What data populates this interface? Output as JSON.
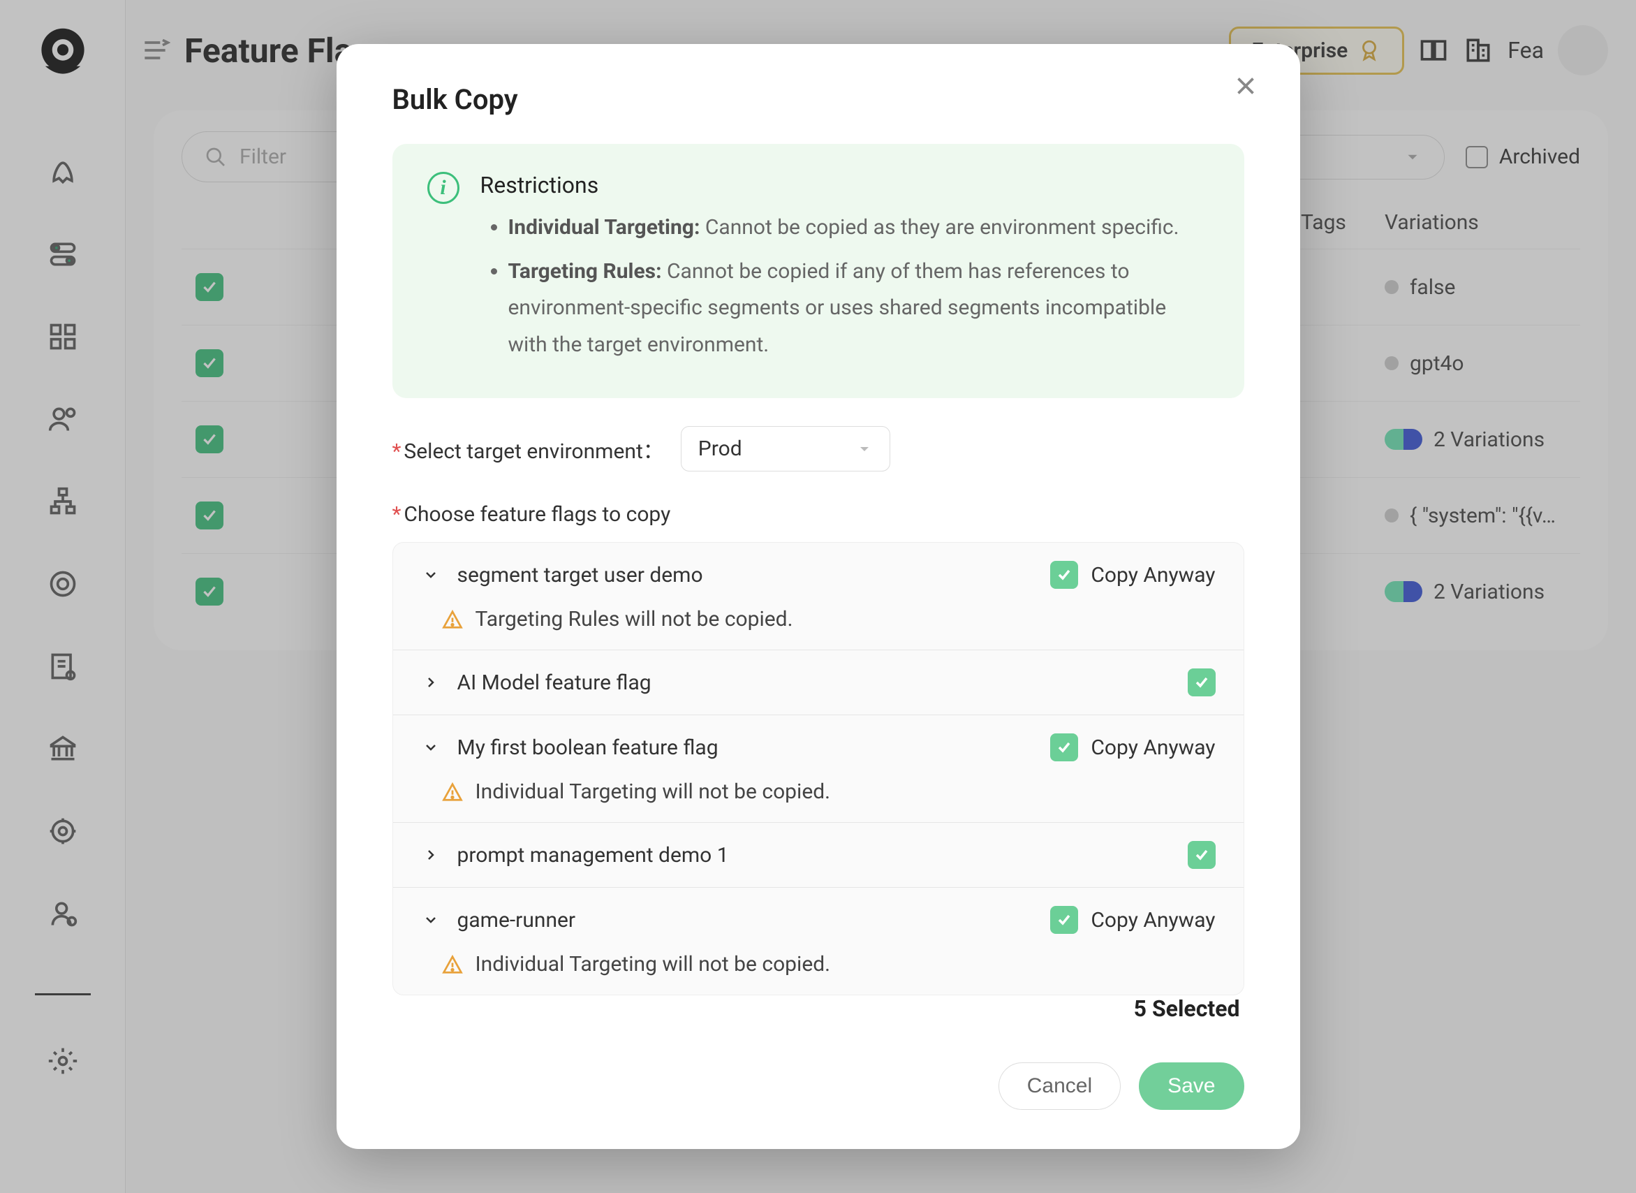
{
  "page": {
    "title": "Feature Flags"
  },
  "topbar": {
    "enterprise_label": "Enterprise",
    "workspace_label": "Fea"
  },
  "filter": {
    "placeholder": "Filter",
    "archived_label": "Archived"
  },
  "table": {
    "cols": {
      "tags": "Tags",
      "variations": "Variations"
    },
    "rows": [
      {
        "variation_text": "false",
        "variation_kind": "dot"
      },
      {
        "variation_text": "gpt4o",
        "variation_kind": "dot"
      },
      {
        "variation_text": "2 Variations",
        "variation_kind": "toggle"
      },
      {
        "variation_text": "{ \"system\": \"{{v…",
        "variation_kind": "dot"
      },
      {
        "variation_text": "2 Variations",
        "variation_kind": "toggle"
      }
    ]
  },
  "modal": {
    "title": "Bulk Copy",
    "restrictions": {
      "heading": "Restrictions",
      "individual_label": "Individual Targeting:",
      "individual_text": "Cannot be copied as they are environment specific.",
      "rules_label": "Targeting Rules:",
      "rules_text": "Cannot be copied if any of them has references to environment-specific segments or uses shared segments incompatible with the target environment."
    },
    "select_env_label": "Select target environment",
    "env_value": "Prod",
    "choose_label": "Choose feature flags to copy",
    "copy_anyway_label": "Copy Anyway",
    "items": [
      {
        "name": "segment target user demo",
        "expanded": true,
        "copy_anyway": true,
        "warning": "Targeting Rules will not be copied."
      },
      {
        "name": "AI Model feature flag",
        "expanded": false,
        "copy_anyway": false,
        "warning": null
      },
      {
        "name": "My first boolean feature flag",
        "expanded": true,
        "copy_anyway": true,
        "warning": "Individual Targeting will not be copied."
      },
      {
        "name": "prompt management demo 1",
        "expanded": false,
        "copy_anyway": false,
        "warning": null
      },
      {
        "name": "game-runner",
        "expanded": true,
        "copy_anyway": true,
        "warning": "Individual Targeting will not be copied."
      }
    ],
    "selected_text": "5 Selected",
    "cancel": "Cancel",
    "save": "Save"
  }
}
